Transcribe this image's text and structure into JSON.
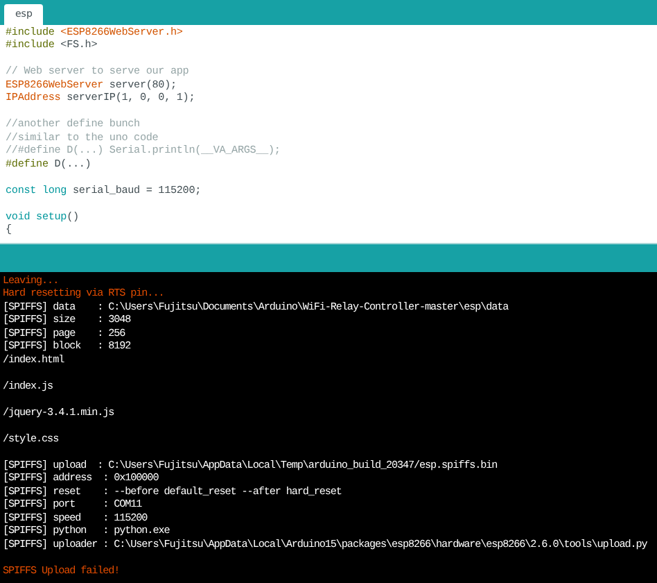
{
  "tabs": [
    {
      "label": "esp",
      "selected": true
    }
  ],
  "editor": {
    "lines": [
      {
        "kind": "code",
        "segments": [
          {
            "text": "#include ",
            "kind": "directive"
          },
          {
            "text": "<ESP8266WebServer.h>",
            "kind": "type"
          }
        ]
      },
      {
        "kind": "code",
        "segments": [
          {
            "text": "#include ",
            "kind": "directive"
          },
          {
            "text": "<FS.h>",
            "kind": "plain"
          }
        ]
      },
      {
        "kind": "blank"
      },
      {
        "kind": "code",
        "segments": [
          {
            "text": "// Web server to serve our app",
            "kind": "comment"
          }
        ]
      },
      {
        "kind": "code",
        "segments": [
          {
            "text": "ESP8266WebServer",
            "kind": "type"
          },
          {
            "text": " server(80);",
            "kind": "plain"
          }
        ]
      },
      {
        "kind": "code",
        "segments": [
          {
            "text": "IPAddress",
            "kind": "type"
          },
          {
            "text": " serverIP(1, 0, 0, 1);",
            "kind": "plain"
          }
        ]
      },
      {
        "kind": "blank"
      },
      {
        "kind": "code",
        "segments": [
          {
            "text": "//another define bunch",
            "kind": "comment"
          }
        ]
      },
      {
        "kind": "code",
        "segments": [
          {
            "text": "//similar to the uno code",
            "kind": "comment"
          }
        ]
      },
      {
        "kind": "code",
        "segments": [
          {
            "text": "//#define D(...) Serial.println(__VA_ARGS__);",
            "kind": "comment"
          }
        ]
      },
      {
        "kind": "code",
        "segments": [
          {
            "text": "#define",
            "kind": "directive"
          },
          {
            "text": " D(...)",
            "kind": "plain"
          }
        ]
      },
      {
        "kind": "blank"
      },
      {
        "kind": "code",
        "segments": [
          {
            "text": "const long",
            "kind": "keyword"
          },
          {
            "text": " serial_baud = 115200;",
            "kind": "plain"
          }
        ]
      },
      {
        "kind": "blank"
      },
      {
        "kind": "code",
        "segments": [
          {
            "text": "void setup",
            "kind": "keyword"
          },
          {
            "text": "()",
            "kind": "plain"
          }
        ]
      },
      {
        "kind": "code",
        "segments": [
          {
            "text": "{",
            "kind": "plain"
          }
        ]
      }
    ]
  },
  "console": {
    "lines": [
      {
        "kind": "warning",
        "text": "Leaving..."
      },
      {
        "kind": "warning",
        "text": "Hard resetting via RTS pin..."
      },
      {
        "kind": "info",
        "text": "[SPIFFS] data    : C:\\Users\\Fujitsu\\Documents\\Arduino\\WiFi-Relay-Controller-master\\esp\\data"
      },
      {
        "kind": "info",
        "text": "[SPIFFS] size    : 3048"
      },
      {
        "kind": "info",
        "text": "[SPIFFS] page    : 256"
      },
      {
        "kind": "info",
        "text": "[SPIFFS] block   : 8192"
      },
      {
        "kind": "info",
        "text": "/index.html"
      },
      {
        "kind": "blank"
      },
      {
        "kind": "info",
        "text": "/index.js"
      },
      {
        "kind": "blank"
      },
      {
        "kind": "info",
        "text": "/jquery-3.4.1.min.js"
      },
      {
        "kind": "blank"
      },
      {
        "kind": "info",
        "text": "/style.css"
      },
      {
        "kind": "blank"
      },
      {
        "kind": "info",
        "text": "[SPIFFS] upload  : C:\\Users\\Fujitsu\\AppData\\Local\\Temp\\arduino_build_20347/esp.spiffs.bin"
      },
      {
        "kind": "info",
        "text": "[SPIFFS] address  : 0x100000"
      },
      {
        "kind": "info",
        "text": "[SPIFFS] reset    : --before default_reset --after hard_reset"
      },
      {
        "kind": "info",
        "text": "[SPIFFS] port     : COM11"
      },
      {
        "kind": "info",
        "text": "[SPIFFS] speed    : 115200"
      },
      {
        "kind": "info",
        "text": "[SPIFFS] python   : python.exe"
      },
      {
        "kind": "info",
        "text": "[SPIFFS] uploader : C:\\Users\\Fujitsu\\AppData\\Local\\Arduino15\\packages\\esp8266\\hardware\\esp8266\\2.6.0\\tools\\upload.py"
      },
      {
        "kind": "blank"
      },
      {
        "kind": "warning",
        "text": "SPIFFS Upload failed!"
      }
    ]
  }
}
